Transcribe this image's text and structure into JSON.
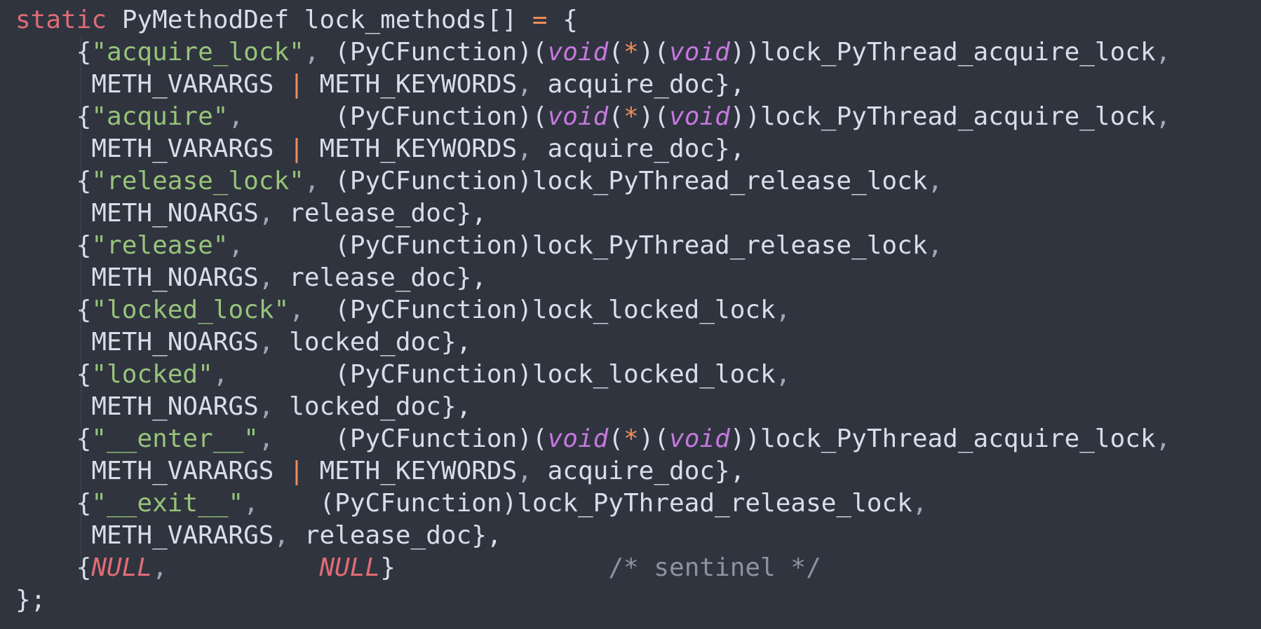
{
  "editor": {
    "lines": [
      [
        {
          "t": "static",
          "c": "kw"
        },
        {
          "t": " PyMethodDef lock_methods[] ",
          "c": "plain"
        },
        {
          "t": "=",
          "c": "op"
        },
        {
          "t": " {",
          "c": "plain"
        }
      ],
      [
        {
          "t": "    {",
          "c": "plain"
        },
        {
          "t": "\"acquire_lock\"",
          "c": "str"
        },
        {
          "t": ", ",
          "c": "comma"
        },
        {
          "t": "(PyCFunction)(",
          "c": "plain"
        },
        {
          "t": "void",
          "c": "type"
        },
        {
          "t": "(",
          "c": "plain"
        },
        {
          "t": "*",
          "c": "op"
        },
        {
          "t": ")(",
          "c": "plain"
        },
        {
          "t": "void",
          "c": "type"
        },
        {
          "t": "))lock_PyThread_acquire_lock",
          "c": "plain"
        },
        {
          "t": ",",
          "c": "comma"
        }
      ],
      [
        {
          "t": "     METH_VARARGS ",
          "c": "plain"
        },
        {
          "t": "|",
          "c": "op"
        },
        {
          "t": " METH_KEYWORDS",
          "c": "plain"
        },
        {
          "t": ", ",
          "c": "comma"
        },
        {
          "t": "acquire_doc},",
          "c": "plain"
        }
      ],
      [
        {
          "t": "    {",
          "c": "plain"
        },
        {
          "t": "\"acquire\"",
          "c": "str"
        },
        {
          "t": ",      ",
          "c": "comma"
        },
        {
          "t": "(PyCFunction)(",
          "c": "plain"
        },
        {
          "t": "void",
          "c": "type"
        },
        {
          "t": "(",
          "c": "plain"
        },
        {
          "t": "*",
          "c": "op"
        },
        {
          "t": ")(",
          "c": "plain"
        },
        {
          "t": "void",
          "c": "type"
        },
        {
          "t": "))lock_PyThread_acquire_lock",
          "c": "plain"
        },
        {
          "t": ",",
          "c": "comma"
        }
      ],
      [
        {
          "t": "     METH_VARARGS ",
          "c": "plain"
        },
        {
          "t": "|",
          "c": "op"
        },
        {
          "t": " METH_KEYWORDS",
          "c": "plain"
        },
        {
          "t": ", ",
          "c": "comma"
        },
        {
          "t": "acquire_doc},",
          "c": "plain"
        }
      ],
      [
        {
          "t": "    {",
          "c": "plain"
        },
        {
          "t": "\"release_lock\"",
          "c": "str"
        },
        {
          "t": ", ",
          "c": "comma"
        },
        {
          "t": "(PyCFunction)lock_PyThread_release_lock",
          "c": "plain"
        },
        {
          "t": ",",
          "c": "comma"
        }
      ],
      [
        {
          "t": "     METH_NOARGS",
          "c": "plain"
        },
        {
          "t": ", ",
          "c": "comma"
        },
        {
          "t": "release_doc},",
          "c": "plain"
        }
      ],
      [
        {
          "t": "    {",
          "c": "plain"
        },
        {
          "t": "\"release\"",
          "c": "str"
        },
        {
          "t": ",      ",
          "c": "comma"
        },
        {
          "t": "(PyCFunction)lock_PyThread_release_lock",
          "c": "plain"
        },
        {
          "t": ",",
          "c": "comma"
        }
      ],
      [
        {
          "t": "     METH_NOARGS",
          "c": "plain"
        },
        {
          "t": ", ",
          "c": "comma"
        },
        {
          "t": "release_doc},",
          "c": "plain"
        }
      ],
      [
        {
          "t": "    {",
          "c": "plain"
        },
        {
          "t": "\"locked_lock\"",
          "c": "str"
        },
        {
          "t": ",  ",
          "c": "comma"
        },
        {
          "t": "(PyCFunction)lock_locked_lock",
          "c": "plain"
        },
        {
          "t": ",",
          "c": "comma"
        }
      ],
      [
        {
          "t": "     METH_NOARGS",
          "c": "plain"
        },
        {
          "t": ", ",
          "c": "comma"
        },
        {
          "t": "locked_doc},",
          "c": "plain"
        }
      ],
      [
        {
          "t": "    {",
          "c": "plain"
        },
        {
          "t": "\"locked\"",
          "c": "str"
        },
        {
          "t": ",       ",
          "c": "comma"
        },
        {
          "t": "(PyCFunction)lock_locked_lock",
          "c": "plain"
        },
        {
          "t": ",",
          "c": "comma"
        }
      ],
      [
        {
          "t": "     METH_NOARGS",
          "c": "plain"
        },
        {
          "t": ", ",
          "c": "comma"
        },
        {
          "t": "locked_doc},",
          "c": "plain"
        }
      ],
      [
        {
          "t": "    {",
          "c": "plain"
        },
        {
          "t": "\"__enter__\"",
          "c": "str"
        },
        {
          "t": ",    ",
          "c": "comma"
        },
        {
          "t": "(PyCFunction)(",
          "c": "plain"
        },
        {
          "t": "void",
          "c": "type"
        },
        {
          "t": "(",
          "c": "plain"
        },
        {
          "t": "*",
          "c": "op"
        },
        {
          "t": ")(",
          "c": "plain"
        },
        {
          "t": "void",
          "c": "type"
        },
        {
          "t": "))lock_PyThread_acquire_lock",
          "c": "plain"
        },
        {
          "t": ",",
          "c": "comma"
        }
      ],
      [
        {
          "t": "     METH_VARARGS ",
          "c": "plain"
        },
        {
          "t": "|",
          "c": "op"
        },
        {
          "t": " METH_KEYWORDS",
          "c": "plain"
        },
        {
          "t": ", ",
          "c": "comma"
        },
        {
          "t": "acquire_doc},",
          "c": "plain"
        }
      ],
      [
        {
          "t": "    {",
          "c": "plain"
        },
        {
          "t": "\"__exit__\"",
          "c": "str"
        },
        {
          "t": ",    ",
          "c": "comma"
        },
        {
          "t": "(PyCFunction)lock_PyThread_release_lock",
          "c": "plain"
        },
        {
          "t": ",",
          "c": "comma"
        }
      ],
      [
        {
          "t": "     METH_VARARGS",
          "c": "plain"
        },
        {
          "t": ", ",
          "c": "comma"
        },
        {
          "t": "release_doc},",
          "c": "plain"
        }
      ],
      [
        {
          "t": "    {",
          "c": "plain"
        },
        {
          "t": "NULL",
          "c": "null"
        },
        {
          "t": ",          ",
          "c": "comma"
        },
        {
          "t": "NULL",
          "c": "null"
        },
        {
          "t": "}",
          "c": "plain"
        },
        {
          "t": "              /* sentinel */",
          "c": "cmt"
        }
      ],
      [
        {
          "t": "};",
          "c": "plain"
        }
      ]
    ]
  }
}
